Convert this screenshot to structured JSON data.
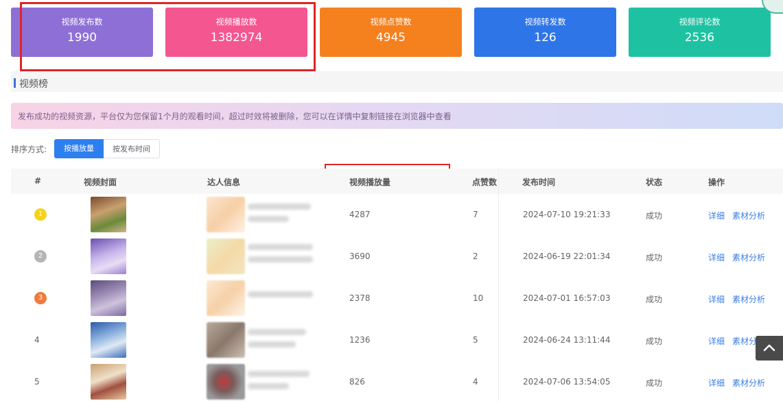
{
  "stats": [
    {
      "label": "视频发布数",
      "value": "1990",
      "color": "#8e6fd6"
    },
    {
      "label": "视频播放数",
      "value": "1382974",
      "color": "#f4568f"
    },
    {
      "label": "视频点赞数",
      "value": "4945",
      "color": "#f5811e"
    },
    {
      "label": "视频转发数",
      "value": "126",
      "color": "#2e75e8"
    },
    {
      "label": "视频评论数",
      "value": "2536",
      "color": "#1ec2a2"
    }
  ],
  "section": {
    "title": "视频榜"
  },
  "notice": {
    "text": "发布成功的视频资源，平台仅为您保留1个月的观看时间，超过时效将被删除，您可以在详情中复制链接在浏览器中查看"
  },
  "sort": {
    "label": "排序方式:",
    "options": [
      "按播放量",
      "按发布时间"
    ],
    "active": "按播放量"
  },
  "table": {
    "headers": [
      "#",
      "视频封面",
      "达人信息",
      "视频播放量",
      "点赞数",
      "发布时间",
      "状态",
      "操作"
    ],
    "rows": [
      {
        "rank": "1",
        "plays": "4287",
        "likes": "7",
        "time": "2024-07-10 19:21:33",
        "status": "成功",
        "op_detail": "详细",
        "op_analysis": "素材分析"
      },
      {
        "rank": "2",
        "plays": "3690",
        "likes": "2",
        "time": "2024-06-19 22:01:34",
        "status": "成功",
        "op_detail": "详细",
        "op_analysis": "素材分析"
      },
      {
        "rank": "3",
        "plays": "2378",
        "likes": "10",
        "time": "2024-07-01 16:57:03",
        "status": "成功",
        "op_detail": "详细",
        "op_analysis": "素材分析"
      },
      {
        "rank": "4",
        "plays": "1236",
        "likes": "5",
        "time": "2024-06-24 13:11:44",
        "status": "成功",
        "op_detail": "详细",
        "op_analysis": "素材分析"
      },
      {
        "rank": "5",
        "plays": "826",
        "likes": "4",
        "time": "2024-07-06 13:54:05",
        "status": "成功",
        "op_detail": "详细",
        "op_analysis": "素材分析"
      }
    ],
    "rank_colors": {
      "1": "#f5d31c",
      "2": "#b5b5b5",
      "3": "#ef7a3d"
    }
  },
  "icons": {
    "scroll_top": "chevron-up-icon"
  }
}
